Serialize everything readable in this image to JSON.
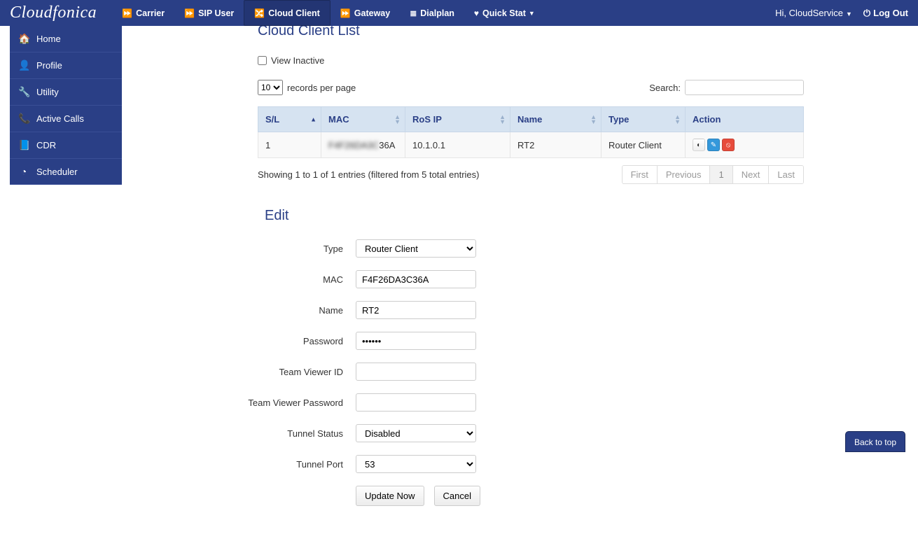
{
  "brand": "Cloudfonica",
  "nav": {
    "items": [
      {
        "label": "Carrier",
        "icon": "⏩"
      },
      {
        "label": "SIP User",
        "icon": "⏩"
      },
      {
        "label": "Cloud Client",
        "icon": "🔀",
        "active": true
      },
      {
        "label": "Gateway",
        "icon": "⏩"
      },
      {
        "label": "Dialplan",
        "icon": "≣"
      },
      {
        "label": "Quick Stat",
        "icon": "♥",
        "caret": true
      }
    ],
    "greeting": "Hi, CloudService",
    "logout": "Log Out"
  },
  "side": [
    {
      "label": "Home",
      "icon": "🏠"
    },
    {
      "label": "Profile",
      "icon": "👤"
    },
    {
      "label": "Utility",
      "icon": "🔧"
    },
    {
      "label": "Active Calls",
      "icon": "📞"
    },
    {
      "label": "CDR",
      "icon": "📘"
    },
    {
      "label": "Scheduler",
      "icon": "◔"
    }
  ],
  "page": {
    "list_title": "Cloud Client List",
    "view_inactive": "View Inactive",
    "records_per_page_text": "records per page",
    "records_select": "10",
    "search_label": "Search:",
    "search_value": "",
    "columns": {
      "sl": "S/L",
      "mac": "MAC",
      "ros": "RoS IP",
      "name": "Name",
      "type": "Type",
      "action": "Action"
    },
    "row": {
      "sl": "1",
      "mac_blur": "F4F26DA3C",
      "mac_tail": "36A",
      "ros": "10.1.0.1",
      "name": "RT2",
      "type": "Router Client"
    },
    "info": "Showing 1 to 1 of 1 entries (filtered from 5 total entries)",
    "pager": {
      "first": "First",
      "prev": "Previous",
      "page": "1",
      "next": "Next",
      "last": "Last"
    }
  },
  "edit": {
    "title": "Edit",
    "labels": {
      "type": "Type",
      "mac": "MAC",
      "name": "Name",
      "password": "Password",
      "tv_id": "Team Viewer ID",
      "tv_pw": "Team Viewer Password",
      "tunnel_status": "Tunnel Status",
      "tunnel_port": "Tunnel Port"
    },
    "values": {
      "type": "Router Client",
      "mac": "F4F26DA3C36A",
      "name": "RT2",
      "password": "••••••",
      "tv_id": "",
      "tv_pw": "",
      "tunnel_status": "Disabled",
      "tunnel_port": "53"
    },
    "buttons": {
      "update": "Update Now",
      "cancel": "Cancel"
    }
  },
  "backtop": "Back to top"
}
